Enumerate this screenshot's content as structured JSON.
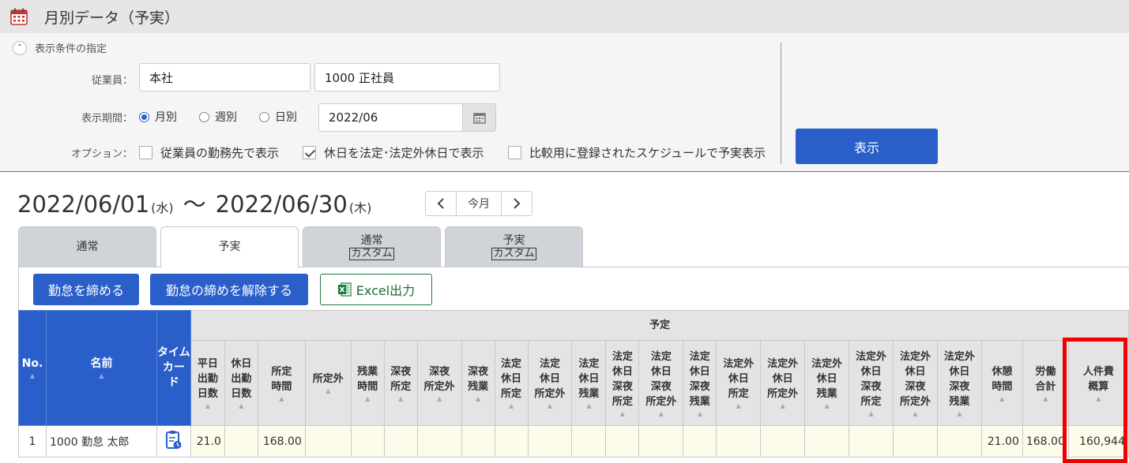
{
  "title": "月別データ（予実）",
  "condition": {
    "toggle_label": "表示条件の指定",
    "employee_label": "従業員：",
    "employee_office": "本社",
    "employee_group": "1000 正社員",
    "period_label": "表示期間：",
    "period_options": [
      "月別",
      "週別",
      "日別"
    ],
    "period_selected": "月別",
    "date_value": "2022/06",
    "option_label": "オプション：",
    "options": [
      {
        "label": "従業員の勤務先で表示",
        "checked": false
      },
      {
        "label": "休日を法定･法定外休日で表示",
        "checked": true
      },
      {
        "label": "比較用に登録されたスケジュールで予実表示",
        "checked": false
      }
    ],
    "show_button": "表示"
  },
  "range": {
    "start": "2022/06/01",
    "start_dow": "(水)",
    "tilde": "〜",
    "end": "2022/06/30",
    "end_dow": "(木)"
  },
  "pager": {
    "prev": "‹",
    "current": "今月",
    "next": "›"
  },
  "tabs": [
    {
      "label": "通常",
      "sub": "",
      "active": false
    },
    {
      "label": "予実",
      "sub": "",
      "active": true
    },
    {
      "label": "通常",
      "sub": "カスタム",
      "active": false
    },
    {
      "label": "予実",
      "sub": "カスタム",
      "active": false
    }
  ],
  "actions": {
    "close_label": "勤怠を締める",
    "unclose_label": "勤怠の締めを解除する",
    "excel_label": "Excel出力"
  },
  "table": {
    "group_label": "予定",
    "col_no": "No.",
    "col_name": "名前",
    "col_card": "タイム\nカード",
    "columns": [
      "平日\n出勤\n日数",
      "休日\n出勤\n日数",
      "所定\n時間",
      "所定外",
      "残業\n時間",
      "深夜\n所定",
      "深夜\n所定外",
      "深夜\n残業",
      "法定\n休日\n所定",
      "法定\n休日\n所定外",
      "法定\n休日\n残業",
      "法定\n休日\n深夜\n所定",
      "法定\n休日\n深夜\n所定外",
      "法定\n休日\n深夜\n残業",
      "法定外\n休日\n所定",
      "法定外\n休日\n所定外",
      "法定外\n休日\n残業",
      "法定外\n休日\n深夜\n所定",
      "法定外\n休日\n深夜\n所定外",
      "法定外\n休日\n深夜\n残業",
      "休憩\n時間",
      "労働\n合計",
      "人件費\n概算"
    ],
    "rows": [
      {
        "no": "1",
        "name": "1000 勤怠 太郎",
        "values": [
          "21.0",
          "",
          "168.00",
          "",
          "",
          "",
          "",
          "",
          "",
          "",
          "",
          "",
          "",
          "",
          "",
          "",
          "",
          "",
          "",
          "",
          "21.00",
          "168.00",
          "160,944"
        ]
      }
    ]
  },
  "colors": {
    "accent": "#2a5fc9",
    "highlight": "#ee0000",
    "excel_green": "#1d7a3e"
  }
}
